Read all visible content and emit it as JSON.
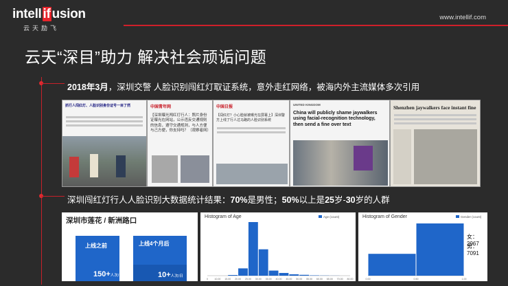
{
  "header": {
    "logo_left": "intell",
    "logo_if": "if",
    "logo_right": "usion",
    "logo_sub": "云天励飞",
    "url": "www.intellif.com"
  },
  "slide": {
    "title": "云天“深目”助力 解决社会顽诟问题"
  },
  "point1": {
    "year": "2018",
    "year_unit": "年",
    "month": "3",
    "month_unit": "月",
    "rest": "，深圳交警 人脸识别闯红灯取证系统，意外走红网络，被海内外主流媒体多次引用"
  },
  "point2": {
    "prefix": "深圳闯红灯行人人脸识别大数据统计结果：",
    "male_pct": "70%",
    "mid1": "是男性；",
    "age_pct": "50%",
    "mid2": "以上是",
    "age_from": "25",
    "mid3": "岁-",
    "age_to": "30",
    "mid4": "岁的人群"
  },
  "news": {
    "n1_title": "抓行人闯红灯、人脸识别身份证号一目了然",
    "n2_source": "中国青年网",
    "n2_text": "【深圳曝光闯红灯行人：照片身份证曝光在网站，公示违反交通规则的信息，遵守交通规则，与人方便与己方便，你支持吗？（观察者网）",
    "n3_source": "中国日报",
    "n3_text": "【闯红灯？小心脸就被曝光在屏幕上】深圳警方上线了行人过马路的人脸识别系统",
    "n4_source": "UNITED KINGDOM",
    "n4_headline": "China will publicly shame jaywalkers using facial-recognition technology, then send a fine over text",
    "n5_headline": "Shenzhen jaywalkers face instant fine"
  },
  "panel1": {
    "title": "深圳市莲花 / 新洲路口",
    "before_label": "上线之前",
    "after_label": "上线4个月后",
    "before_value": "150+",
    "before_unit": "人次/日",
    "after_value": "10+",
    "after_unit": "人次/日"
  },
  "panel2": {
    "title": "Histogram of Age",
    "legend": "Age (count)",
    "x_ticks": [
      "0",
      "10.00",
      "15.00",
      "20.00",
      "25.00",
      "30.00",
      "35.00",
      "40.00",
      "45.00",
      "50.00",
      "55.00",
      "60.00",
      "65.00",
      "70.00",
      "80.00"
    ]
  },
  "panel3": {
    "title": "Histogram of Gender",
    "legend": "Gender (count)",
    "female_label": "女：2967",
    "male_label": "男：7091",
    "x_ticks": [
      "0.00",
      "0.50",
      "1.00"
    ]
  },
  "chart_data": [
    {
      "type": "bar",
      "title": "Histogram of Age",
      "categories": [
        "0-10",
        "10-15",
        "15-20",
        "20-25",
        "25-30",
        "30-35",
        "35-40",
        "40-45",
        "45-50",
        "50-55",
        "55-60",
        "60-65",
        "65-70",
        "70-80"
      ],
      "series": [
        {
          "name": "Age (count)",
          "values": [
            0,
            0,
            40,
            430,
            3150,
            1550,
            300,
            160,
            80,
            50,
            20,
            10,
            5,
            0
          ]
        }
      ]
    },
    {
      "type": "bar",
      "title": "Histogram of Gender",
      "categories": [
        "0.00-0.50",
        "0.50-1.00"
      ],
      "series": [
        {
          "name": "Gender (count)",
          "values": [
            2967,
            7091
          ]
        }
      ]
    }
  ],
  "colors": {
    "background": "#2b2b2b",
    "accent_red": "#d0202a",
    "bar_blue": "#1f66c9"
  }
}
